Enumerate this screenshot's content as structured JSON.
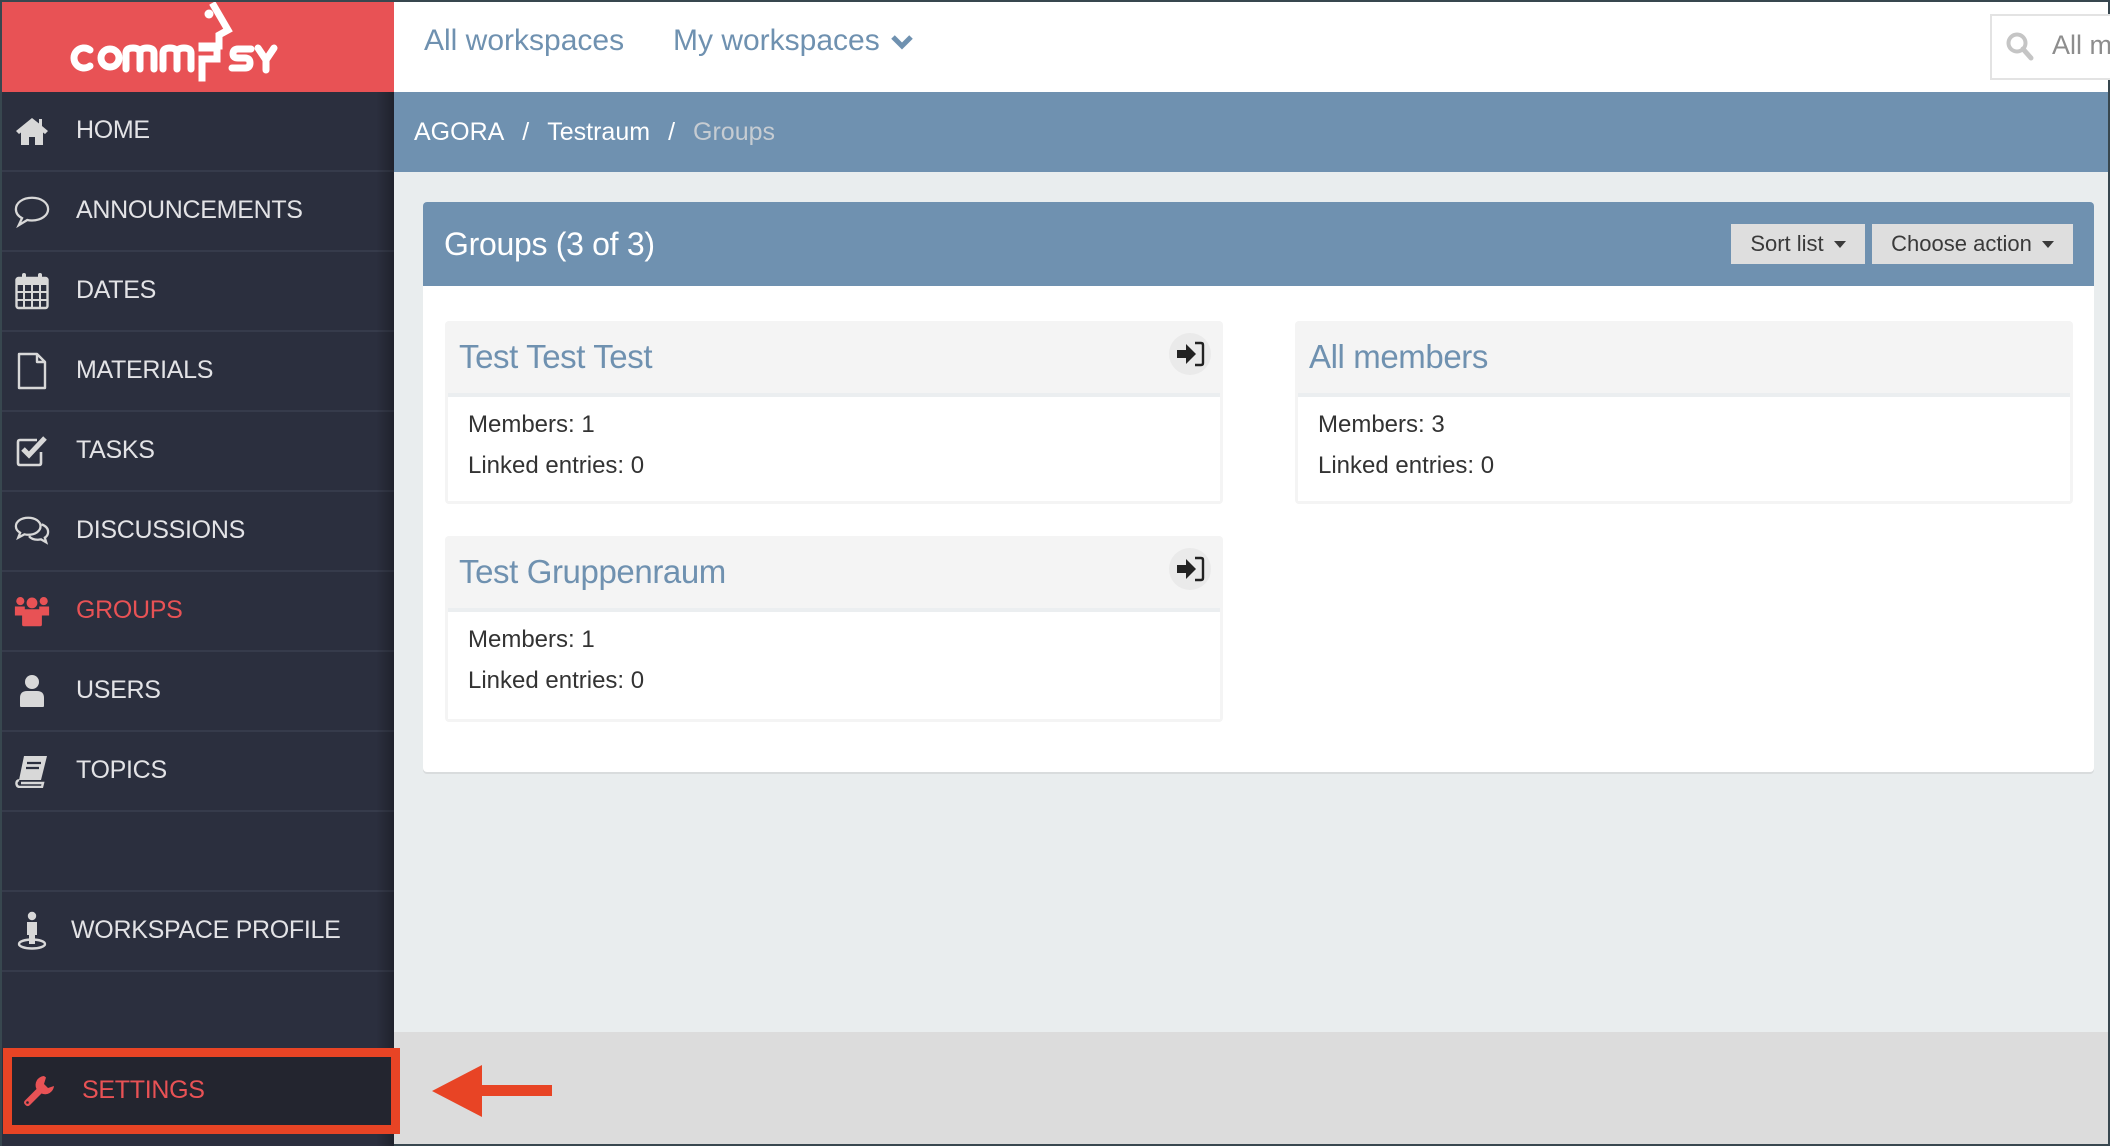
{
  "app": {
    "logo_text": "commsy",
    "brand_color": "#e85255",
    "accent_color": "#6f91b0"
  },
  "topbar": {
    "all_workspaces": "All workspaces",
    "my_workspaces": "My workspaces",
    "search_placeholder": "All my..."
  },
  "breadcrumb": {
    "items": [
      "AGORA",
      "Testraum",
      "Groups"
    ],
    "separator": "/"
  },
  "sidebar": {
    "items": [
      {
        "label": "HOME",
        "icon": "home-icon"
      },
      {
        "label": "ANNOUNCEMENTS",
        "icon": "speech-bubble-icon"
      },
      {
        "label": "DATES",
        "icon": "calendar-icon"
      },
      {
        "label": "MATERIALS",
        "icon": "file-icon"
      },
      {
        "label": "TASKS",
        "icon": "checkbox-icon"
      },
      {
        "label": "DISCUSSIONS",
        "icon": "comments-icon"
      },
      {
        "label": "GROUPS",
        "icon": "group-icon",
        "active": true
      },
      {
        "label": "USERS",
        "icon": "user-icon"
      },
      {
        "label": "TOPICS",
        "icon": "book-icon"
      }
    ],
    "workspace_profile": "WORKSPACE PROFILE",
    "settings": "SETTINGS"
  },
  "panel": {
    "title": "Groups (3 of 3)",
    "sort_button": "Sort list",
    "action_button": "Choose action"
  },
  "groups": [
    {
      "title": "Test Test Test",
      "members": "Members: 1",
      "linked": "Linked entries: 0",
      "can_enter": true
    },
    {
      "title": "All members",
      "members": "Members: 3",
      "linked": "Linked entries: 0",
      "can_enter": false
    },
    {
      "title": "Test Gruppenraum",
      "members": "Members: 1",
      "linked": "Linked entries: 0",
      "can_enter": true
    }
  ],
  "annotation": {
    "highlight_color": "#e84425",
    "target": "SETTINGS"
  }
}
